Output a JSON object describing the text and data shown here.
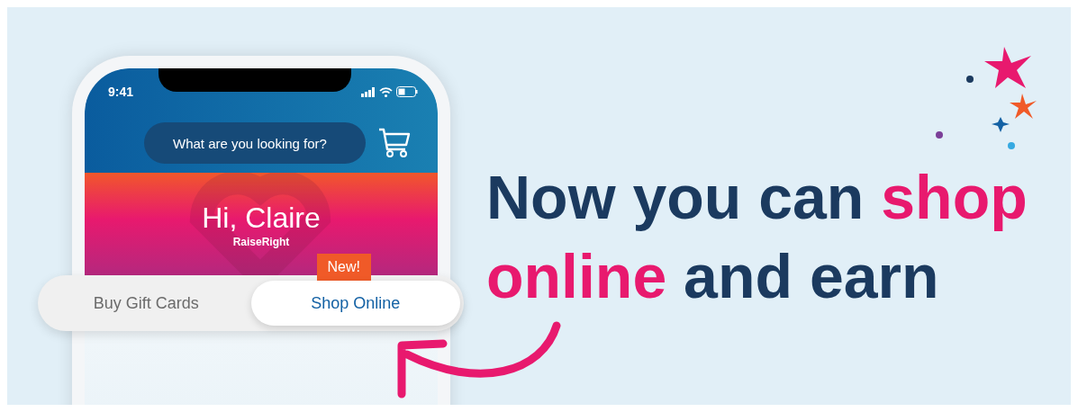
{
  "phone": {
    "status_bar": {
      "time": "9:41"
    },
    "search": {
      "placeholder": "What are you looking for?"
    },
    "greeting": {
      "title": "Hi, Claire",
      "brand": "RaiseRight"
    },
    "tabs": [
      {
        "label": "Buy Gift Cards",
        "selected": false
      },
      {
        "label": "Shop Online",
        "selected": true,
        "badge": "New!"
      }
    ]
  },
  "headline": {
    "lines": [
      [
        {
          "text": "Now you can ",
          "highlight": false
        },
        {
          "text": "shop",
          "highlight": true
        }
      ],
      [
        {
          "text": "online",
          "highlight": true
        },
        {
          "text": " and earn",
          "highlight": false
        }
      ]
    ]
  }
}
